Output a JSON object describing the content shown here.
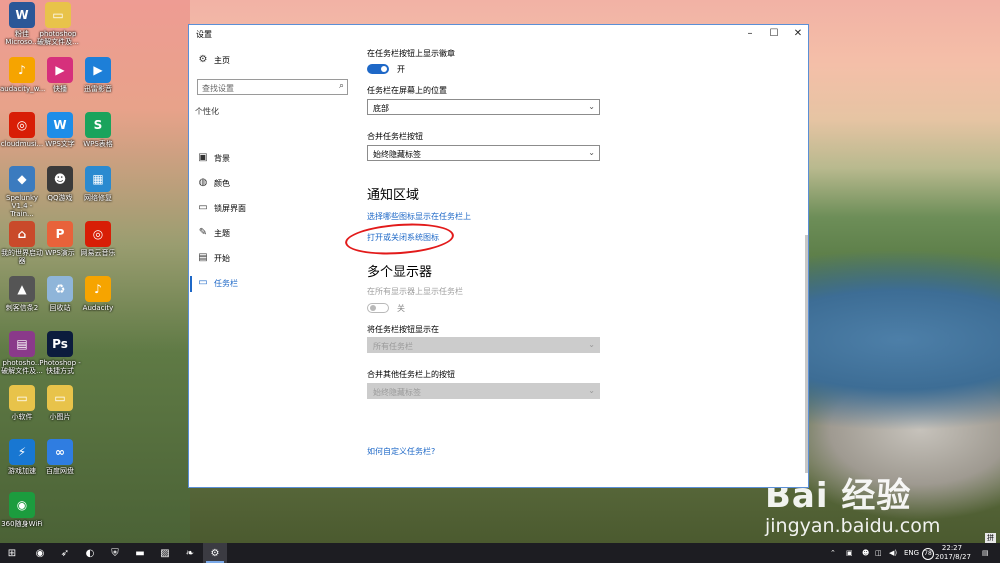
{
  "desktop": {
    "icons": [
      {
        "label": "粉佳 Microso...",
        "icon": "word-doc-icon",
        "color": "#2b5797",
        "glyph": "W"
      },
      {
        "label": "photoshop 破解文件及...",
        "icon": "folder-icon",
        "color": "#e8c34a",
        "glyph": "▭"
      },
      {
        "label": "audacity_w...",
        "icon": "audacity-headphones-icon",
        "color": "#f6a400",
        "glyph": "♪"
      },
      {
        "label": "快播",
        "icon": "video-player-icon",
        "color": "#d6307c",
        "glyph": "▶"
      },
      {
        "label": "迅雷影音",
        "icon": "xunlei-player-icon",
        "color": "#1d7fd8",
        "glyph": "▶"
      },
      {
        "label": "cloudmusi...",
        "icon": "netease-music-icon",
        "color": "#d81e06",
        "glyph": "◎"
      },
      {
        "label": "WPS文字",
        "icon": "wps-writer-icon",
        "color": "#1e8de8",
        "glyph": "W"
      },
      {
        "label": "WPS表格",
        "icon": "wps-sheet-icon",
        "color": "#1aa35c",
        "glyph": "S"
      },
      {
        "label": "Spelunky V1.4 - Train...",
        "icon": "game-icon",
        "color": "#3b7bbf",
        "glyph": "◆"
      },
      {
        "label": "QQ游戏",
        "icon": "qq-game-icon",
        "color": "#3a3a3a",
        "glyph": "☻"
      },
      {
        "label": "网络修复",
        "icon": "network-repair-icon",
        "color": "#2a8ad0",
        "glyph": "▦"
      },
      {
        "label": "我的世界启动器",
        "icon": "minecraft-house-icon",
        "color": "#c94a2a",
        "glyph": "⌂"
      },
      {
        "label": "WPS演示",
        "icon": "wps-presentation-icon",
        "color": "#e8623a",
        "glyph": "P"
      },
      {
        "label": "网易云音乐",
        "icon": "netease-cloud-music-icon",
        "color": "#d81e06",
        "glyph": "◎"
      },
      {
        "label": "刺客信条2",
        "icon": "assassin-creed-icon",
        "color": "#555555",
        "glyph": "▲"
      },
      {
        "label": "回收站",
        "icon": "recycle-bin-icon",
        "color": "#8fb5d9",
        "glyph": "♻"
      },
      {
        "label": "Audacity",
        "icon": "audacity-icon",
        "color": "#f6a400",
        "glyph": "♪"
      },
      {
        "label": "photosho... 破解文件及...",
        "icon": "winrar-archive-icon",
        "color": "#8a3a8a",
        "glyph": "▤"
      },
      {
        "label": "Photoshop - 快捷方式",
        "icon": "photoshop-icon",
        "color": "#0c1c3d",
        "glyph": "Ps"
      },
      {
        "label": "小软件",
        "icon": "folder-icon-small-software",
        "color": "#e8c34a",
        "glyph": "▭"
      },
      {
        "label": "小图片",
        "icon": "folder-icon-small-pictures",
        "color": "#e8c34a",
        "glyph": "▭"
      },
      {
        "label": "游戏加速",
        "icon": "game-boost-icon",
        "color": "#1877d2",
        "glyph": "⚡"
      },
      {
        "label": "百度网盘",
        "icon": "baidu-netdisk-icon",
        "color": "#2f7de1",
        "glyph": "∞"
      },
      {
        "label": "360随身WiFi",
        "icon": "wifi-360-icon",
        "color": "#1c9c3e",
        "glyph": "◉"
      }
    ],
    "watermark_text": "Bai 经验",
    "watermark_url": "jingyan.baidu.com"
  },
  "window": {
    "title": "设置",
    "controls": {
      "minimize": "–",
      "maximize": "☐",
      "close": "✕"
    }
  },
  "sidebar": {
    "home_label": "主页",
    "search_placeholder": "查找设置",
    "section": "个性化",
    "items": [
      {
        "label": "背景",
        "icon": "picture-icon"
      },
      {
        "label": "颜色",
        "icon": "palette-icon"
      },
      {
        "label": "锁屏界面",
        "icon": "lock-screen-icon"
      },
      {
        "label": "主题",
        "icon": "theme-brush-icon"
      },
      {
        "label": "开始",
        "icon": "start-menu-icon"
      },
      {
        "label": "任务栏",
        "icon": "taskbar-icon",
        "active": true
      }
    ]
  },
  "main": {
    "badges_label": "在任务栏按钮上显示徽章",
    "badges_state": "开",
    "position_label": "任务栏在屏幕上的位置",
    "position_value": "底部",
    "combine_label": "合并任务栏按钮",
    "combine_value": "始终隐藏标签",
    "notification_heading": "通知区域",
    "select_icons_link": "选择哪些图标显示在任务栏上",
    "system_icons_link": "打开或关闭系统图标",
    "multi_heading": "多个显示器",
    "show_all_label": "在所有显示器上显示任务栏",
    "show_all_state": "关",
    "show_buttons_label": "将任务栏按钮显示在",
    "show_buttons_value": "所有任务栏",
    "combine_other_label": "合并其他任务栏上的按钮",
    "combine_other_value": "始终隐藏标签",
    "customize_link": "如何自定义任务栏?"
  },
  "taskbar": {
    "start_icon": "windows-start-icon",
    "apps": [
      {
        "icon": "browser-360-icon",
        "glyph": "◉"
      },
      {
        "icon": "browser-feather-icon",
        "glyph": "➶"
      },
      {
        "icon": "xunlei-icon",
        "glyph": "◐"
      },
      {
        "icon": "shield-security-icon",
        "glyph": "⛨"
      },
      {
        "icon": "file-explorer-icon",
        "glyph": "▬"
      },
      {
        "icon": "photos-icon",
        "glyph": "▨"
      },
      {
        "icon": "feather-app-icon",
        "glyph": "❧"
      },
      {
        "icon": "settings-gear-icon",
        "glyph": "⚙",
        "active": true
      }
    ],
    "tray_lang": "ENG",
    "tray_badge": "78",
    "time": "22:27",
    "date": "2017/8/27",
    "input_mode": "拼"
  },
  "colors": {
    "accent": "#1e68c7",
    "annotation": "#e21a1a",
    "taskbar_bg": "#1d1d22"
  }
}
